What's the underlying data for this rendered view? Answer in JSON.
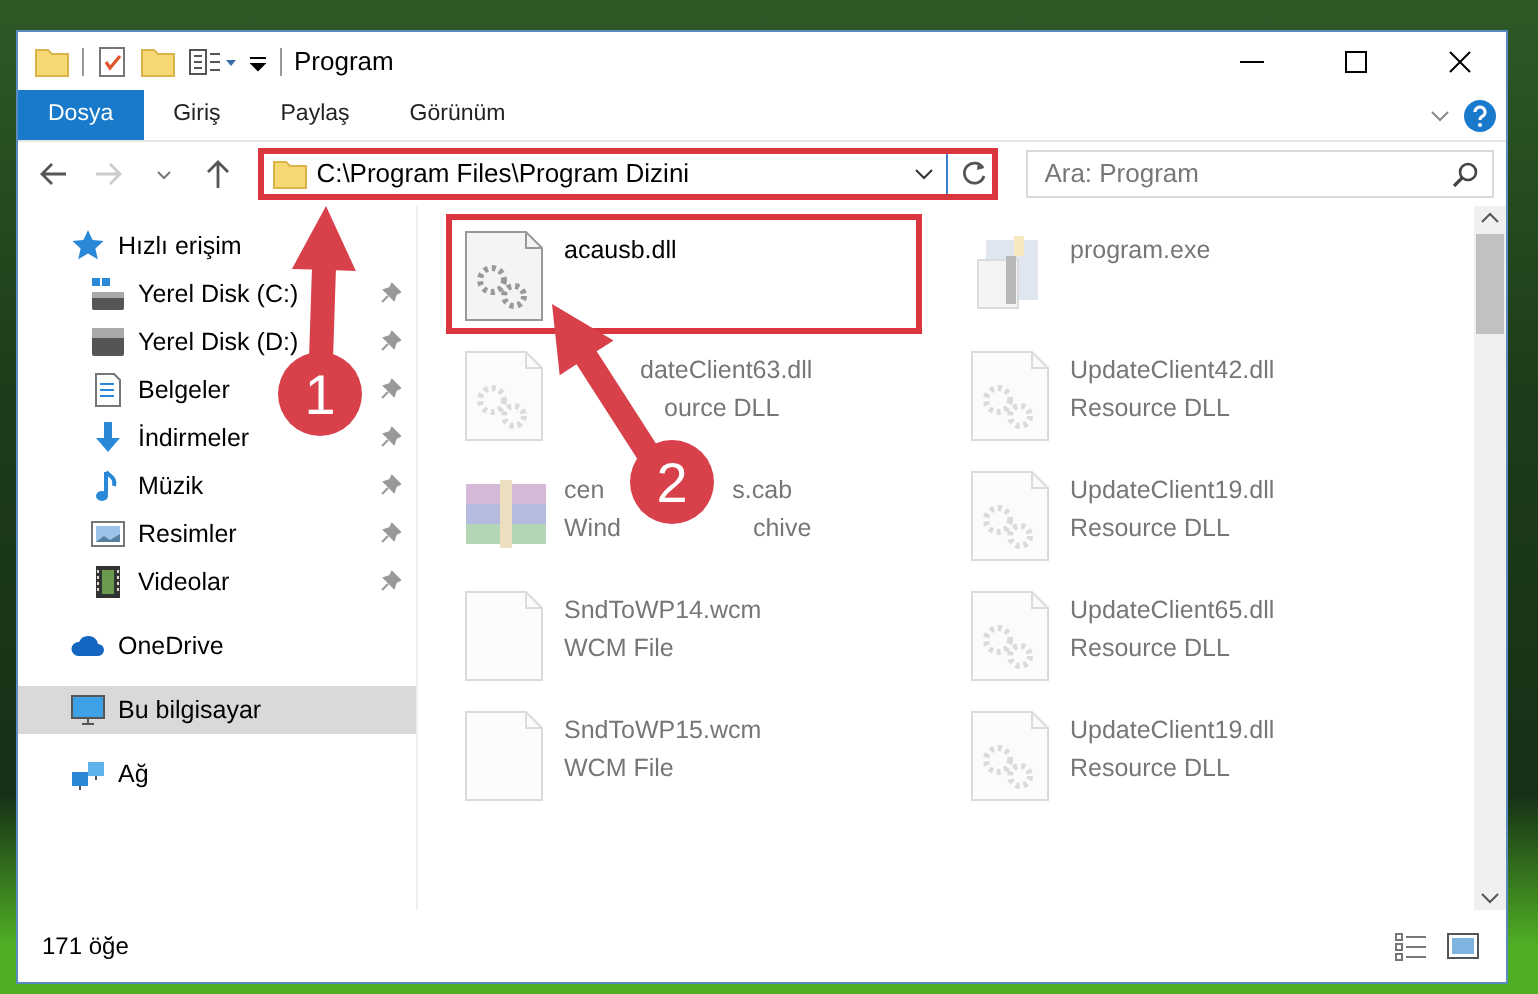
{
  "window": {
    "title": "Program"
  },
  "ribbon_tabs": [
    {
      "label": "Dosya",
      "selected": true
    },
    {
      "label": "Giriş",
      "selected": false
    },
    {
      "label": "Paylaş",
      "selected": false
    },
    {
      "label": "Görünüm",
      "selected": false
    }
  ],
  "address": {
    "path": "C:\\Program Files\\Program Dizini",
    "highlighted": true
  },
  "search": {
    "placeholder": "Ara: Program"
  },
  "sidebar": {
    "items": [
      {
        "label": "Hızlı erişim",
        "kind": "star",
        "selected": false,
        "children": [
          {
            "label": "Yerel Disk (C:)",
            "kind": "drive-c",
            "pinned": true,
            "selected": false
          },
          {
            "label": "Yerel Disk (D:)",
            "kind": "drive",
            "pinned": true,
            "selected": false
          },
          {
            "label": "Belgeler",
            "kind": "document",
            "pinned": true,
            "selected": false
          },
          {
            "label": "İndirmeler",
            "kind": "download",
            "pinned": true,
            "selected": false
          },
          {
            "label": "Müzik",
            "kind": "music",
            "pinned": true,
            "selected": false
          },
          {
            "label": "Resimler",
            "kind": "image",
            "pinned": true,
            "selected": false
          },
          {
            "label": "Videolar",
            "kind": "film",
            "pinned": true,
            "selected": false
          }
        ]
      },
      {
        "label": "OneDrive",
        "kind": "cloud",
        "selected": false
      },
      {
        "label": "Bu bilgisayar",
        "kind": "computer",
        "selected": true
      },
      {
        "label": "Ağ",
        "kind": "network",
        "selected": false
      }
    ]
  },
  "files": [
    {
      "name": [
        "acausb.dll"
      ],
      "kind": "dll",
      "faded": false,
      "highlighted": true
    },
    {
      "name": [
        "program.exe"
      ],
      "kind": "exe",
      "faded": true,
      "highlighted": false
    },
    {
      "name": [
        "dateClient63.dll"
      ],
      "type": [
        "ource DLL"
      ],
      "kind": "dll",
      "faded": true,
      "highlighted": false
    },
    {
      "name": [
        "UpdateClient42.dll"
      ],
      "type": [
        "Resource DLL"
      ],
      "kind": "dll",
      "faded": true,
      "highlighted": false
    },
    {
      "name": [
        "cen",
        "s.cab"
      ],
      "type": [
        "Wind",
        "chive"
      ],
      "kind": "archive",
      "faded": true,
      "highlighted": false
    },
    {
      "name": [
        "UpdateClient19.dll"
      ],
      "type": [
        "Resource DLL"
      ],
      "kind": "dll",
      "faded": true,
      "highlighted": false
    },
    {
      "name": [
        "SndToWP14.wcm"
      ],
      "type": [
        "WCM File"
      ],
      "kind": "blank",
      "faded": true,
      "highlighted": false
    },
    {
      "name": [
        "UpdateClient65.dll"
      ],
      "type": [
        "Resource DLL"
      ],
      "kind": "dll",
      "faded": true,
      "highlighted": false
    },
    {
      "name": [
        "SndToWP15.wcm"
      ],
      "type": [
        "WCM File"
      ],
      "kind": "blank",
      "faded": true,
      "highlighted": false
    },
    {
      "name": [
        "UpdateClient19.dll"
      ],
      "type": [
        "Resource DLL"
      ],
      "kind": "dll",
      "faded": true,
      "highlighted": false
    }
  ],
  "markers": [
    {
      "label": "1"
    },
    {
      "label": "2"
    }
  ],
  "status_bar": {
    "count": "171 öğe"
  }
}
